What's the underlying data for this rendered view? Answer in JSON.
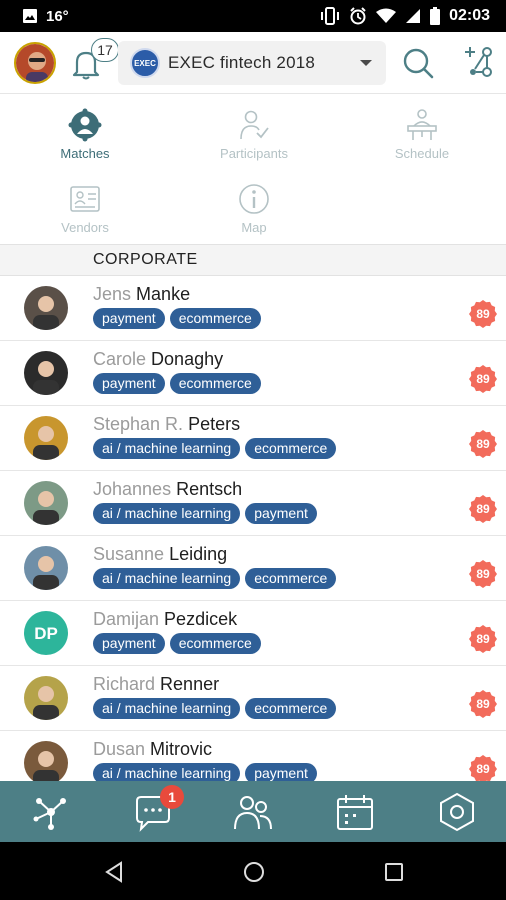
{
  "status_bar": {
    "signal_text": "16°",
    "time": "02:03"
  },
  "header": {
    "notification_count": "17",
    "event_logo_text": "EXEC",
    "event_name": "EXEC fintech 2018"
  },
  "tabs": [
    {
      "label": "Matches",
      "icon": "matches-icon",
      "active": true
    },
    {
      "label": "Participants",
      "icon": "participants-icon",
      "active": false
    },
    {
      "label": "Schedule",
      "icon": "schedule-icon",
      "active": false
    },
    {
      "label": "Vendors",
      "icon": "vendors-icon",
      "active": false
    },
    {
      "label": "Map",
      "icon": "map-info-icon",
      "active": false
    }
  ],
  "section": {
    "title": "CORPORATE"
  },
  "people": [
    {
      "first": "Jens",
      "last": "Manke",
      "tags": [
        "payment",
        "ecommerce"
      ],
      "score": "89",
      "avatar_color": "#5a5048"
    },
    {
      "first": "Carole",
      "last": "Donaghy",
      "tags": [
        "payment",
        "ecommerce"
      ],
      "score": "89",
      "avatar_color": "#2b2b2b"
    },
    {
      "first": "Stephan R.",
      "last": "Peters",
      "tags": [
        "ai / machine learning",
        "ecommerce"
      ],
      "score": "89",
      "avatar_color": "#c8962e"
    },
    {
      "first": "Johannes",
      "last": "Rentsch",
      "tags": [
        "ai / machine learning",
        "payment"
      ],
      "score": "89",
      "avatar_color": "#7d9a86"
    },
    {
      "first": "Susanne",
      "last": "Leiding",
      "tags": [
        "ai / machine learning",
        "ecommerce"
      ],
      "score": "89",
      "avatar_color": "#6f8fa8"
    },
    {
      "first": "Damijan",
      "last": "Pezdicek",
      "tags": [
        "payment",
        "ecommerce"
      ],
      "score": "89",
      "initials": "DP",
      "avatar_color": "#2db59b"
    },
    {
      "first": "Richard",
      "last": "Renner",
      "tags": [
        "ai / machine learning",
        "ecommerce"
      ],
      "score": "89",
      "avatar_color": "#b5a34a"
    },
    {
      "first": "Dusan",
      "last": "Mitrovic",
      "tags": [
        "ai / machine learning",
        "payment"
      ],
      "score": "89",
      "avatar_color": "#7a5a3c"
    }
  ],
  "bottom_nav": {
    "chat_badge": "1",
    "items": [
      "network-icon",
      "chat-icon",
      "people-icon",
      "calendar-icon",
      "hexagon-icon"
    ]
  },
  "colors": {
    "accent": "#4d7f86",
    "tag": "#2f5f97",
    "score": "#f26b5b",
    "badge": "#e84a3c"
  }
}
